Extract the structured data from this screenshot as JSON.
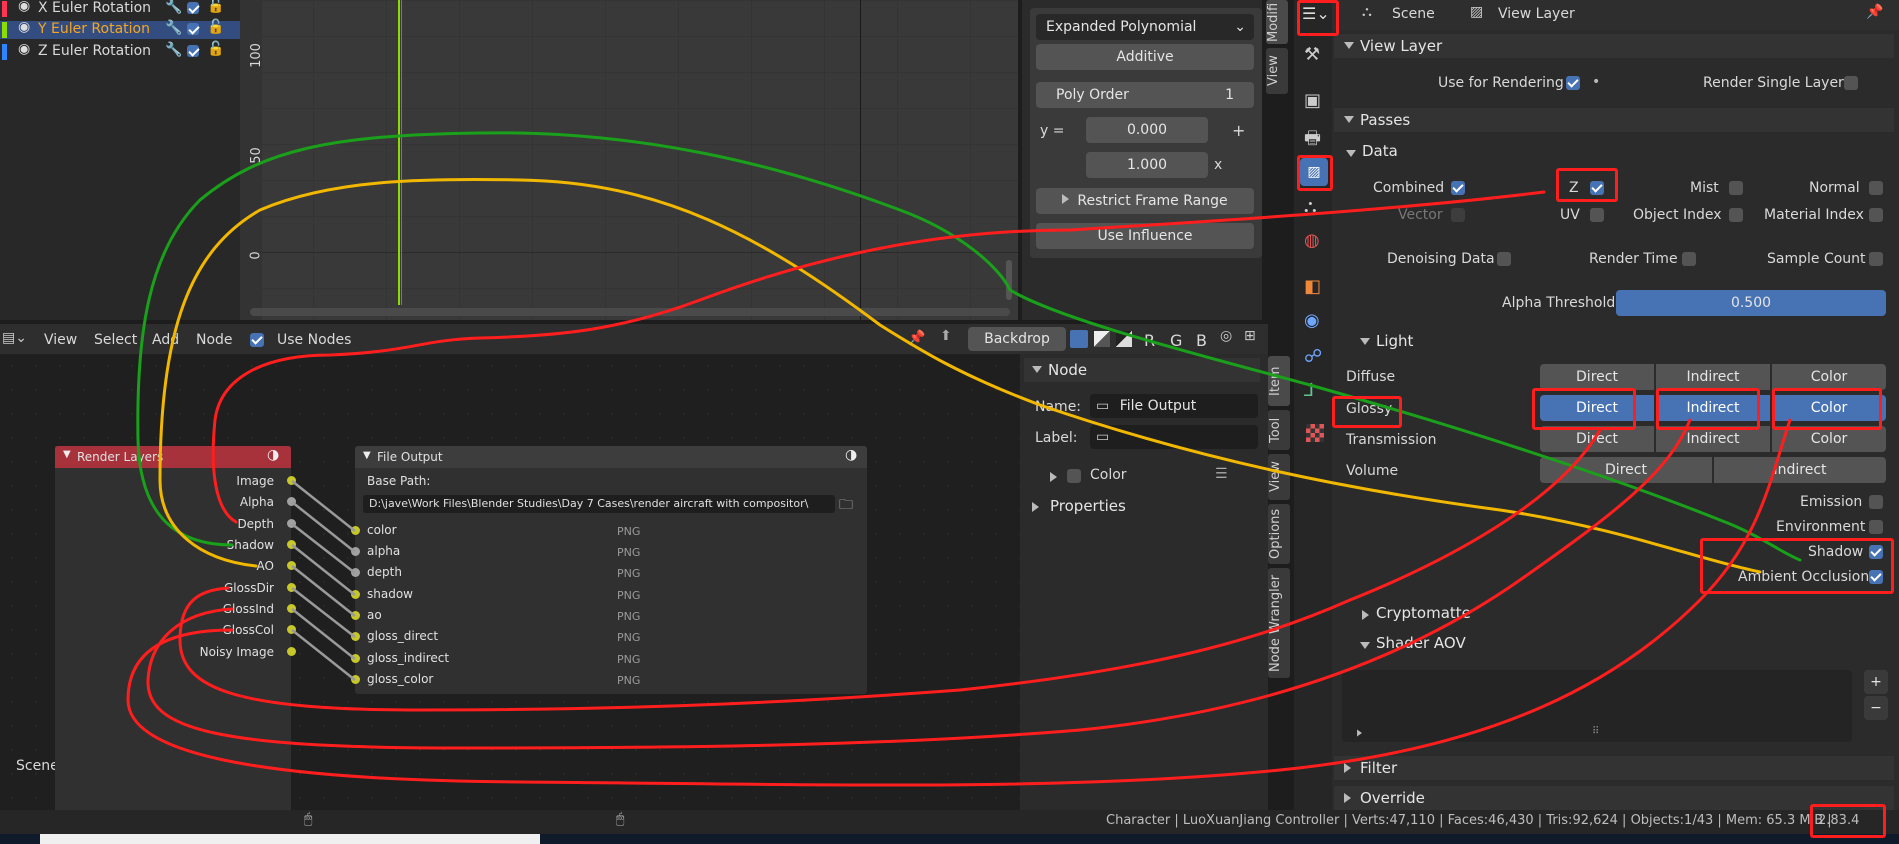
{
  "graph_editor": {
    "channels": [
      {
        "name": "X Euler Rotation",
        "color": "#ff3352"
      },
      {
        "name": "Y Euler Rotation",
        "color": "#8bdc00"
      },
      {
        "name": "Z Euler Rotation",
        "color": "#2f83ff"
      }
    ],
    "y_ticks": [
      "100",
      "50",
      "0"
    ]
  },
  "modifier_panel": {
    "mode": "Expanded Polynomial",
    "blend": "Additive",
    "poly_order_label": "Poly Order",
    "poly_order_value": "1",
    "y_label": "y =",
    "coef0": "0.000",
    "coef1": "1.000",
    "plus": "+",
    "x": "x",
    "restrict_frame_range": "Restrict Frame Range",
    "use_influence": "Use Influence",
    "tab_modifiers": "Modifi",
    "tab_view": "View"
  },
  "node_editor_header": {
    "menu": [
      "View",
      "Select",
      "Add",
      "Node"
    ],
    "use_nodes": "Use Nodes",
    "backdrop": "Backdrop",
    "channels": [
      "R",
      "G",
      "B"
    ]
  },
  "render_layers_node": {
    "title": "Render Layers",
    "outputs": [
      "Image",
      "Alpha",
      "Depth",
      "Shadow",
      "AO",
      "GlossDir",
      "GlossInd",
      "GlossCol",
      "Noisy Image"
    ],
    "scene_label": "Scene"
  },
  "file_output_node": {
    "title": "File Output",
    "base_path_label": "Base Path:",
    "base_path": "D:\\jave\\Work Files\\Blender Studies\\Day 7 Cases\\render aircraft with compositor\\",
    "inputs": [
      "color",
      "alpha",
      "depth",
      "shadow",
      "ao",
      "gloss_direct",
      "gloss_indirect",
      "gloss_color"
    ],
    "format": "PNG"
  },
  "node_sidebar": {
    "node_header": "Node",
    "name_label": "Name:",
    "name_value": "File Output",
    "label_label": "Label:",
    "color": "Color",
    "properties": "Properties",
    "tabs": [
      "Item",
      "Tool",
      "View",
      "Options",
      "Node Wrangler"
    ]
  },
  "properties": {
    "scene": "Scene",
    "view_layer": "View Layer",
    "view_layer_section": "View Layer",
    "use_for_rendering": "Use for Rendering",
    "render_single_layer": "Render Single Layer",
    "passes": "Passes",
    "data": "Data",
    "combined": "Combined",
    "z": "Z",
    "mist": "Mist",
    "normal": "Normal",
    "vector": "Vector",
    "uv": "UV",
    "object_index": "Object Index",
    "material_index": "Material Index",
    "denoising_data": "Denoising Data",
    "render_time": "Render Time",
    "sample_count": "Sample Count",
    "alpha_threshold": "Alpha Threshold",
    "alpha_threshold_value": "0.500",
    "light": "Light",
    "diffuse": "Diffuse",
    "glossy": "Glossy",
    "transmission": "Transmission",
    "volume": "Volume",
    "direct": "Direct",
    "indirect": "Indirect",
    "color": "Color",
    "emission": "Emission",
    "environment": "Environment",
    "shadow": "Shadow",
    "ambient_occlusion": "Ambient Occlusion",
    "cryptomatte": "Cryptomatte",
    "shader_aov": "Shader AOV",
    "filter": "Filter",
    "override": "Override"
  },
  "status_bar": {
    "text": "Character | LuoXuanJiang Controller | Verts:47,110 | Faces:46,430 | Tris:92,624 | Objects:1/43 | Mem: 65.3 MiB |",
    "version": "2.83.4"
  },
  "colors": {
    "accent": "#4772b3",
    "annotation_red": "#ff1e1e",
    "annotation_green": "#1aa01a",
    "annotation_yellow": "#f2b800",
    "node_header_red": "#a7323b"
  }
}
